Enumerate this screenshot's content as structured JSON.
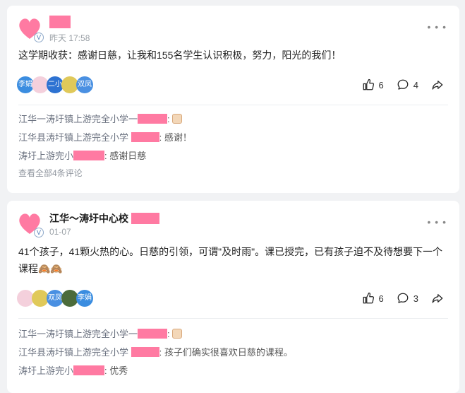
{
  "posts": [
    {
      "author": "",
      "time": "昨天 17:58",
      "content": "这学期收获：感谢日慈，让我和155名学生认识积极，努力，阳光的我们！",
      "likers": [
        {
          "label": "李娟",
          "color": "#3b8de0"
        },
        {
          "label": "",
          "color": "#f4d0dc"
        },
        {
          "label": "二小",
          "color": "#2d72d2"
        },
        {
          "label": "",
          "color": "#e0c95a"
        },
        {
          "label": "双凤",
          "color": "#4a90e2"
        }
      ],
      "likes": "6",
      "comments_count": "4",
      "comments": [
        {
          "name": "江华一涛圩镇上游完全小学一",
          "text": ":",
          "emoji": "thumb"
        },
        {
          "name": "江华县涛圩镇上游完全小学",
          "text": ": 感谢！",
          "emoji": ""
        },
        {
          "name": "涛圩上游完小",
          "text": ": 感谢日慈",
          "emoji": ""
        }
      ],
      "view_all": "查看全部4条评论"
    },
    {
      "author": "江华～涛圩中心校",
      "time": "01-07",
      "content": "41个孩子，41颗火热的心。日慈的引领，可谓\"及时雨\"。课已授完，已有孩子迫不及待想要下一个课程🙈🙈",
      "likers": [
        {
          "label": "",
          "color": "#f4d0dc"
        },
        {
          "label": "",
          "color": "#e0c95a"
        },
        {
          "label": "双凤",
          "color": "#4a90e2"
        },
        {
          "label": "",
          "color": "#4b6b3a"
        },
        {
          "label": "李娟",
          "color": "#3b8de0"
        }
      ],
      "likes": "6",
      "comments_count": "3",
      "comments": [
        {
          "name": "江华一涛圩镇上游完全小学一",
          "text": ":",
          "emoji": "thumb"
        },
        {
          "name": "江华县涛圩镇上游完全小学",
          "text": ": 孩子们确实很喜欢日慈的课程。",
          "emoji": ""
        },
        {
          "name": "涛圩上游完小",
          "text": ": 优秀",
          "emoji": ""
        }
      ]
    }
  ],
  "icons": {
    "like": "thumbs-up-icon",
    "comment": "chat-bubble-icon",
    "share": "share-arrow-icon",
    "more": "more-dots-icon"
  },
  "colors": {
    "redaction": "#ff7aa2",
    "liker_blue": "#3b8de0",
    "background": "#f1f2f4"
  }
}
